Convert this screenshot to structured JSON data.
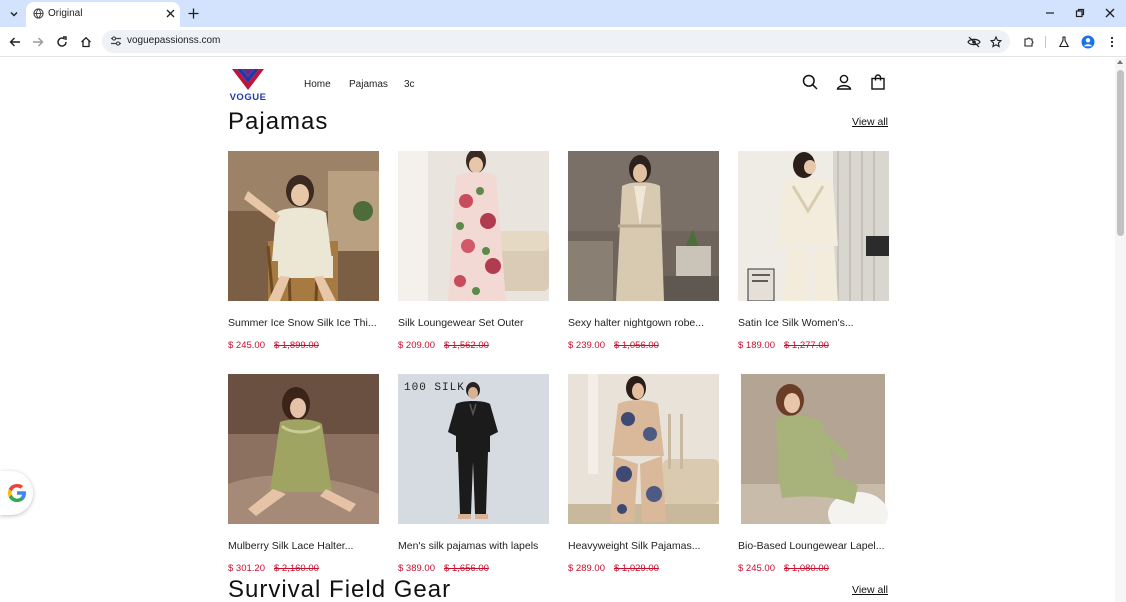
{
  "browser": {
    "tab_title": "Original",
    "url": "voguepassionss.com"
  },
  "site": {
    "logo_text": "VOGUE",
    "nav": [
      "Home",
      "Pajamas",
      "3c"
    ]
  },
  "sections": [
    {
      "title": "Pajamas",
      "view_all": "View all"
    },
    {
      "title": "Survival Field Gear",
      "view_all": "View all"
    }
  ],
  "products": [
    {
      "title": "Summer Ice Snow Silk Ice Thi...",
      "price": "$ 245.00",
      "old_price": "$ 1,899.00"
    },
    {
      "title": "Silk Loungewear Set Outer",
      "price": "$ 209.00",
      "old_price": "$ 1,562.00"
    },
    {
      "title": "Sexy halter nightgown robe...",
      "price": "$ 239.00",
      "old_price": "$ 1,056.00"
    },
    {
      "title": "Satin Ice Silk Women's...",
      "price": "$ 189.00",
      "old_price": "$ 1,277.00"
    },
    {
      "title": "Mulberry Silk Lace Halter...",
      "price": "$ 301.20",
      "old_price": "$ 2,160.00"
    },
    {
      "title": "Men's silk pajamas with lapels",
      "price": "$ 389.00",
      "old_price": "$ 1,656.00"
    },
    {
      "title": "Heavyweight Silk Pajamas...",
      "price": "$ 289.00",
      "old_price": "$ 1,029.00"
    },
    {
      "title": "Bio-Based Loungewear Lapel...",
      "price": "$ 245.00",
      "old_price": "$ 1,080.00"
    }
  ],
  "product_image_text": {
    "men_silk": "100 SILK"
  },
  "colors": {
    "price": "#c8102e",
    "logo_blue": "#1f3aa8",
    "logo_red": "#c0143c",
    "tabstrip": "#d3e3fd"
  }
}
